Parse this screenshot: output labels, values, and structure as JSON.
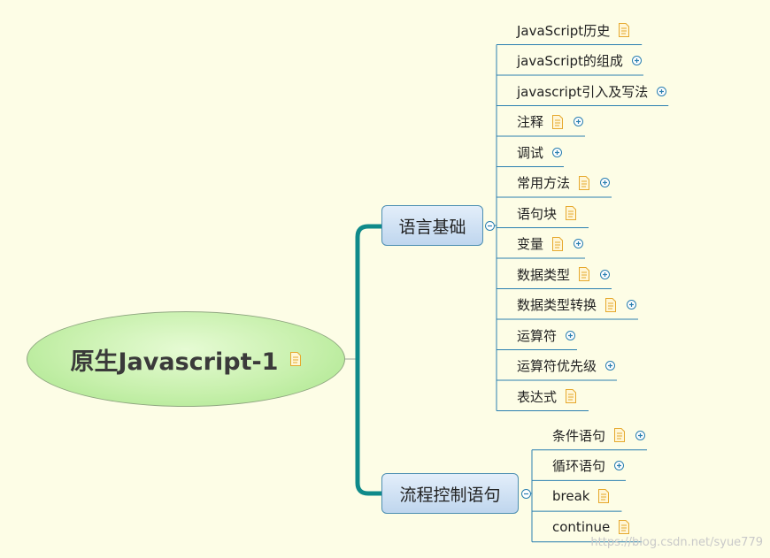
{
  "root": {
    "title": "原生Javascript-1",
    "note_icon": "note-icon"
  },
  "branches": [
    {
      "label": "语言基础",
      "children": [
        {
          "label": "JavaScript历史",
          "note": true,
          "expand": false
        },
        {
          "label": "javaScript的组成",
          "note": false,
          "expand": true
        },
        {
          "label": "javascript引入及写法",
          "note": false,
          "expand": true
        },
        {
          "label": "注释",
          "note": true,
          "expand": true
        },
        {
          "label": "调试",
          "note": false,
          "expand": true
        },
        {
          "label": "常用方法",
          "note": true,
          "expand": true
        },
        {
          "label": "语句块",
          "note": true,
          "expand": false
        },
        {
          "label": "变量",
          "note": true,
          "expand": true
        },
        {
          "label": "数据类型",
          "note": true,
          "expand": true
        },
        {
          "label": "数据类型转换",
          "note": true,
          "expand": true
        },
        {
          "label": "运算符",
          "note": false,
          "expand": true
        },
        {
          "label": "运算符优先级",
          "note": false,
          "expand": true
        },
        {
          "label": "表达式",
          "note": true,
          "expand": false
        }
      ]
    },
    {
      "label": "流程控制语句",
      "children": [
        {
          "label": "条件语句",
          "note": true,
          "expand": true
        },
        {
          "label": "循环语句",
          "note": false,
          "expand": true
        },
        {
          "label": "break",
          "note": true,
          "expand": false
        },
        {
          "label": "continue",
          "note": true,
          "expand": false
        }
      ]
    }
  ],
  "colors": {
    "background": "#fdfde6",
    "connector": "#0f8a8a",
    "branch_border": "#4d8fb2",
    "line": "#2a7fb0",
    "note": "#f5c246"
  },
  "watermark": "https://blog.csdn.net/syue779"
}
